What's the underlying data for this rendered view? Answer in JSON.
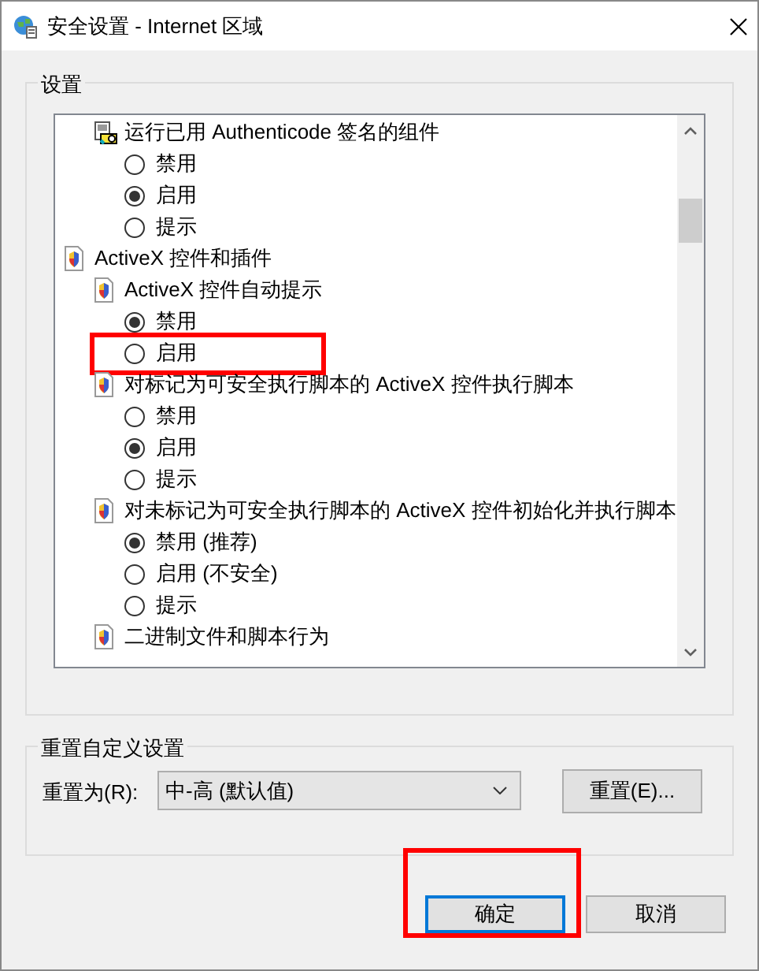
{
  "window": {
    "title": "安全设置 - Internet 区域"
  },
  "settings": {
    "label": "设置",
    "items": [
      {
        "children": [
          {
            "kind": "signed-setting",
            "label": "运行已用 Authenticode 签名的组件",
            "children": [
              {
                "kind": "radio",
                "label": "禁用",
                "selected": false,
                "highlighted": false
              },
              {
                "kind": "radio",
                "label": "启用",
                "selected": true,
                "highlighted": false
              },
              {
                "kind": "radio",
                "label": "提示",
                "selected": false,
                "highlighted": false
              }
            ]
          }
        ]
      },
      {
        "kind": "setting",
        "label": "ActiveX 控件和插件",
        "children": [
          {
            "kind": "setting",
            "label": "ActiveX 控件自动提示",
            "children": [
              {
                "kind": "radio",
                "label": "禁用",
                "selected": true,
                "highlighted": false
              },
              {
                "kind": "radio",
                "label": "启用",
                "selected": false,
                "highlighted": true
              }
            ]
          },
          {
            "kind": "setting",
            "label": "对标记为可安全执行脚本的 ActiveX 控件执行脚本",
            "children": [
              {
                "kind": "radio",
                "label": "禁用",
                "selected": false,
                "highlighted": false
              },
              {
                "kind": "radio",
                "label": "启用",
                "selected": true,
                "highlighted": false
              },
              {
                "kind": "radio",
                "label": "提示",
                "selected": false,
                "highlighted": false
              }
            ]
          },
          {
            "kind": "setting",
            "label": "对未标记为可安全执行脚本的 ActiveX 控件初始化并执行脚本",
            "children": [
              {
                "kind": "radio",
                "label": "禁用 (推荐)",
                "selected": true,
                "highlighted": false
              },
              {
                "kind": "radio",
                "label": "启用 (不安全)",
                "selected": false,
                "highlighted": false
              },
              {
                "kind": "radio",
                "label": "提示",
                "selected": false,
                "highlighted": false
              }
            ]
          },
          {
            "kind": "setting",
            "label": "二进制文件和脚本行为"
          }
        ]
      }
    ]
  },
  "reset": {
    "label": "重置自定义设置",
    "field_label": "重置为(R):",
    "value": "中-高 (默认值)",
    "button": "重置(E)..."
  },
  "buttons": [
    {
      "label": "确定",
      "default": true,
      "highlighted": true
    },
    {
      "label": "取消",
      "default": false,
      "highlighted": false
    }
  ]
}
